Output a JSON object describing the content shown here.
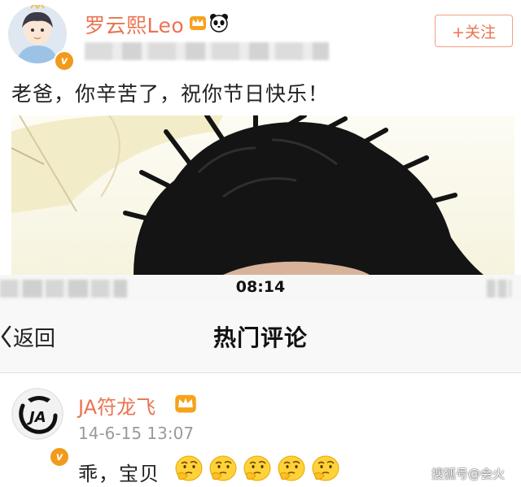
{
  "post": {
    "username": "罗云熙Leo",
    "follow_label": "+关注",
    "text": "老爸，你辛苦了，祝你节日快乐！",
    "verified_badge": "v"
  },
  "status_bar": {
    "time": "08:14"
  },
  "nav": {
    "back_label": "返回",
    "title": "热门评论"
  },
  "comment": {
    "username": "JA符龙飞",
    "timestamp": "14-6-15 13:07",
    "text": "乖，宝贝",
    "emoji_count": 5,
    "emoji_icon": "thinking-face-icon",
    "verified_badge": "v"
  },
  "watermark": "搜狐号@会火",
  "colors": {
    "accent": "#eb7350",
    "verified": "#f29a1b",
    "nav_bg": "#f8f8f8",
    "timestamp": "#9a9a9a"
  }
}
